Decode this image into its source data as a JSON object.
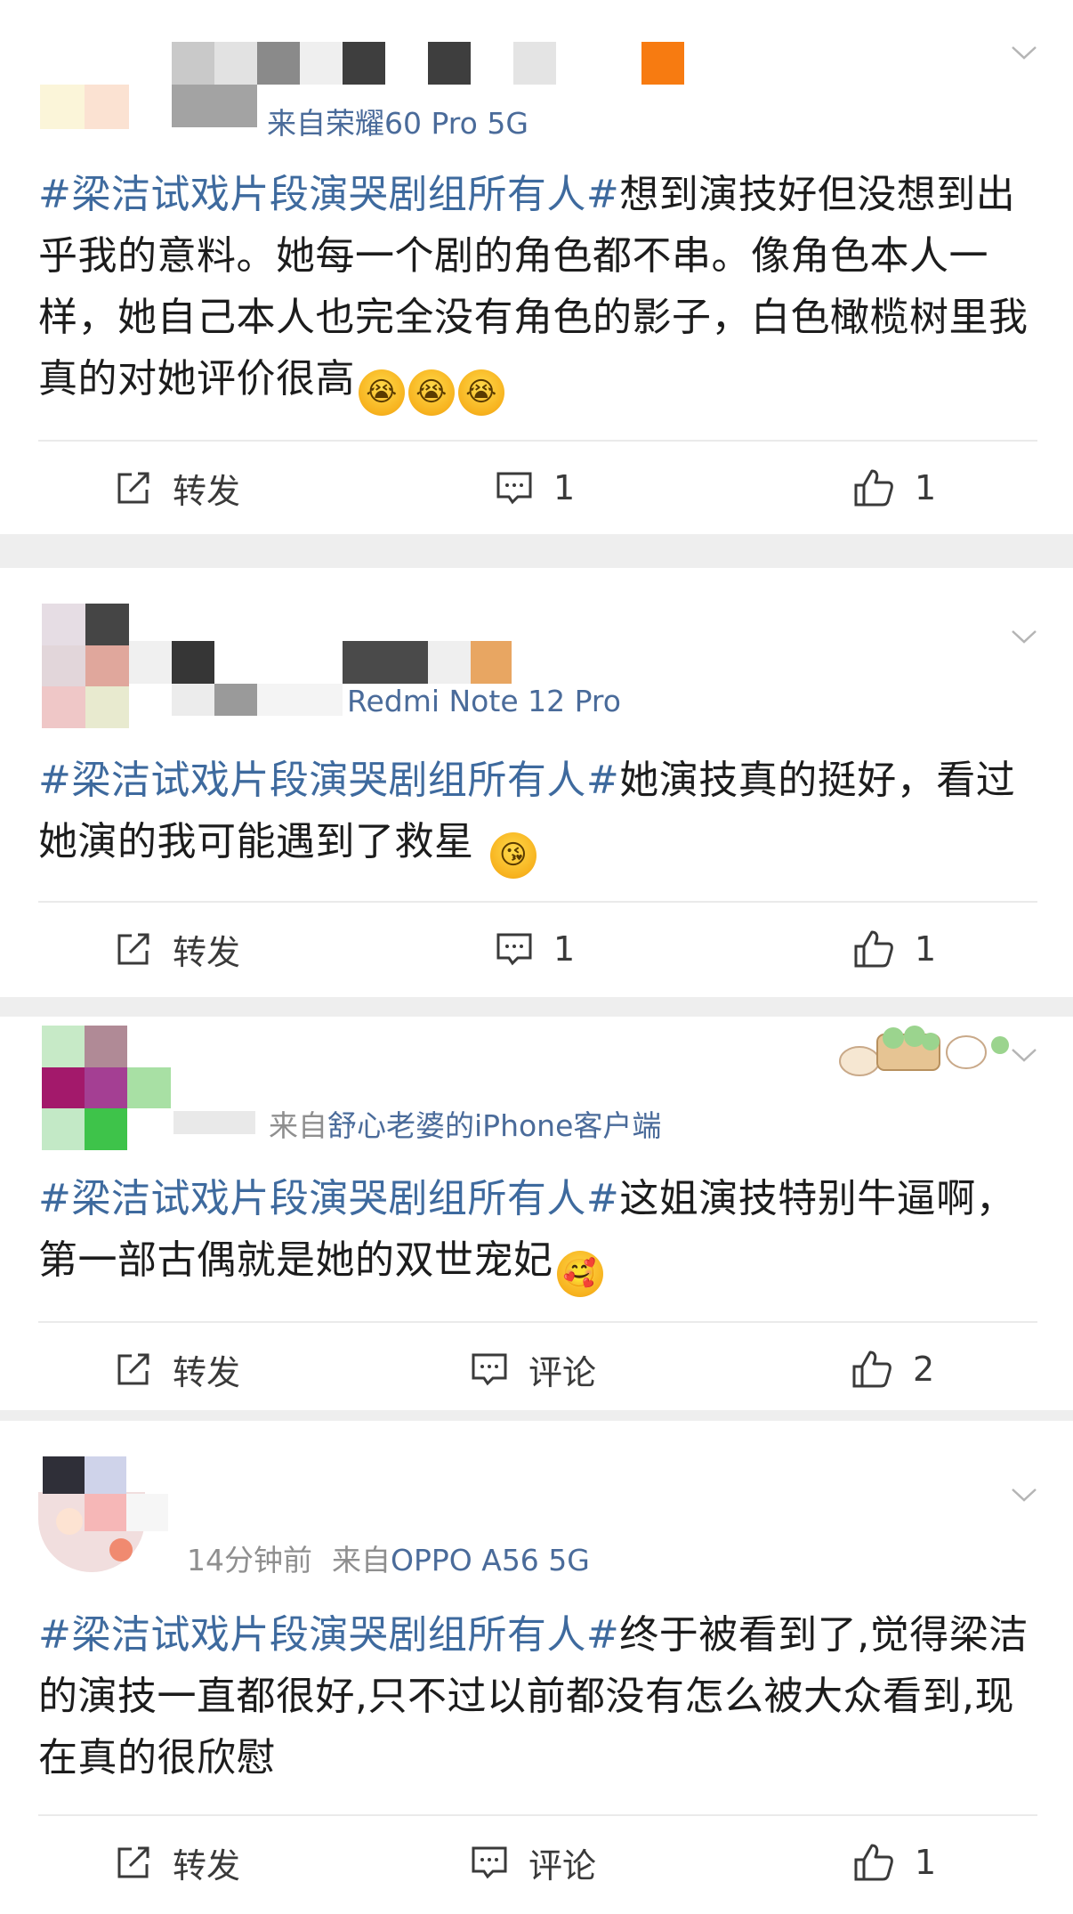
{
  "posts": [
    {
      "meta_source": "来自荣耀60 Pro 5G",
      "hashtag": "#梁洁试戏片段演哭剧组所有人#",
      "text": "想到演技好但没想到出乎我的意料。她每一个剧的角色都不串。像角色本人一样，她自己本人也完全没有角色的影子，白色橄榄树里我真的对她评价很高",
      "emojis": [
        "😭",
        "😭",
        "😭"
      ],
      "repost_label": "转发",
      "comment_label": "1",
      "like_label": "1"
    },
    {
      "meta_source": "Redmi Note 12 Pro",
      "hashtag": "#梁洁试戏片段演哭剧组所有人#",
      "text": "她演技真的挺好，看过她演的我可能遇到了救星",
      "emojis": [
        "😘"
      ],
      "repost_label": "转发",
      "comment_label": "1",
      "like_label": "1"
    },
    {
      "meta_from": "来自",
      "meta_source": "舒心老婆的iPhone客户端",
      "hashtag": "#梁洁试戏片段演哭剧组所有人#",
      "text": "这姐演技特别牛逼啊，第一部古偶就是她的双世宠妃",
      "emojis": [
        "🥰"
      ],
      "repost_label": "转发",
      "comment_label": "评论",
      "like_label": "2"
    },
    {
      "meta_time": "14分钟前",
      "meta_from": "来自",
      "meta_source": "OPPO A56 5G",
      "hashtag": "#梁洁试戏片段演哭剧组所有人#",
      "text": "终于被看到了,觉得梁洁的演技一直都很好,只不过以前都没有怎么被大众看到,现在真的很欣慰",
      "emojis": [],
      "repost_label": "转发",
      "comment_label": "评论",
      "like_label": "1"
    }
  ],
  "colors": {
    "hashtag": "#3e6a9e",
    "source": "#4a6b9a",
    "separator": "#eeeeee",
    "accent_orange": "#f77b11"
  }
}
